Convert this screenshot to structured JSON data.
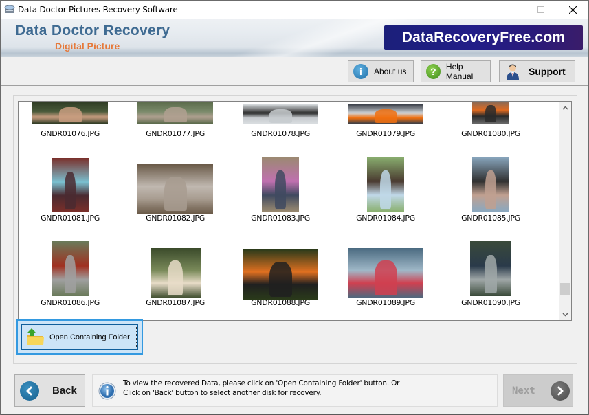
{
  "window": {
    "title": "Data Doctor Pictures Recovery Software",
    "controls": {
      "minimize": "minimize",
      "maximize": "maximize",
      "close": "close"
    }
  },
  "header": {
    "brand_main": "Data Doctor Recovery",
    "brand_sub": "Digital Picture",
    "site_logo": "DataRecoveryFree.com",
    "colors": {
      "brand_main": "#3f6b92",
      "brand_sub": "#e5793a",
      "logo_bg": "#221e88"
    }
  },
  "toolbar": {
    "about_label": "About us",
    "help_label": "Help Manual",
    "support_label": "Support"
  },
  "gallery": {
    "items": [
      {
        "filename": "GNDR01076.JPG"
      },
      {
        "filename": "GNDR01077.JPG"
      },
      {
        "filename": "GNDR01078.JPG"
      },
      {
        "filename": "GNDR01079.JPG"
      },
      {
        "filename": "GNDR01080.JPG"
      },
      {
        "filename": "GNDR01081.JPG"
      },
      {
        "filename": "GNDR01082.JPG"
      },
      {
        "filename": "GNDR01083.JPG"
      },
      {
        "filename": "GNDR01084.JPG"
      },
      {
        "filename": "GNDR01085.JPG"
      },
      {
        "filename": "GNDR01086.JPG"
      },
      {
        "filename": "GNDR01087.JPG"
      },
      {
        "filename": "GNDR01088.JPG"
      },
      {
        "filename": "GNDR01089.JPG"
      },
      {
        "filename": "GNDR01090.JPG"
      }
    ]
  },
  "actions": {
    "open_folder_label": "Open Containing Folder"
  },
  "footer": {
    "back_label": "Back",
    "next_label": "Next",
    "info_line1": "To view the recovered Data, please click on 'Open Containing Folder' button. Or",
    "info_line2": "Click on 'Back' button to select another disk for recovery."
  }
}
